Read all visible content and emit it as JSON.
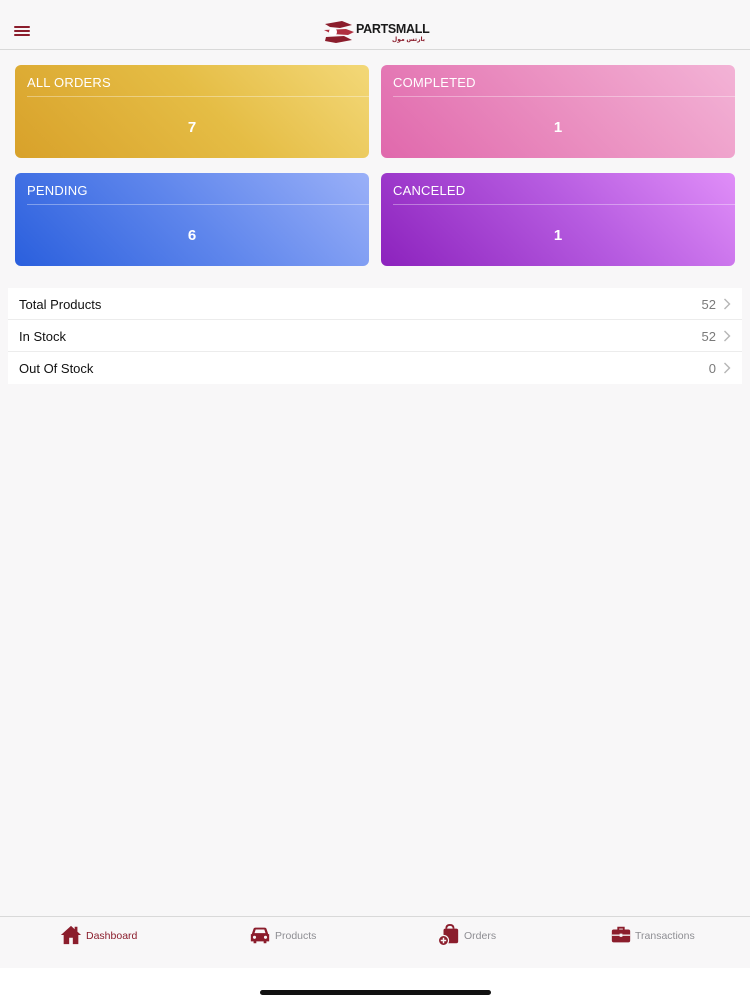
{
  "header": {
    "logo_text": "PARTSMALL",
    "logo_subtext": "بارتس مول"
  },
  "cards": {
    "all_orders": {
      "label": "ALL ORDERS",
      "count": "7"
    },
    "completed": {
      "label": "COMPLETED",
      "count": "1"
    },
    "pending": {
      "label": "PENDING",
      "count": "6"
    },
    "canceled": {
      "label": "CANCELED",
      "count": "1"
    }
  },
  "stock": {
    "rows": [
      {
        "label": "Total Products",
        "value": "52"
      },
      {
        "label": "In Stock",
        "value": "52"
      },
      {
        "label": "Out Of Stock",
        "value": "0"
      }
    ]
  },
  "tabbar": {
    "dashboard": "Dashboard",
    "products": "Products",
    "orders": "Orders",
    "transactions": "Transactions"
  },
  "colors": {
    "brand": "#8b1d2c",
    "inactive": "#8e8e93"
  },
  "icons": {
    "menu": "hamburger-icon",
    "dashboard": "home-icon",
    "products": "car-icon",
    "orders": "shopping-bag-plus-icon",
    "transactions": "briefcase-icon",
    "row_chevron": "chevron-right-icon"
  }
}
